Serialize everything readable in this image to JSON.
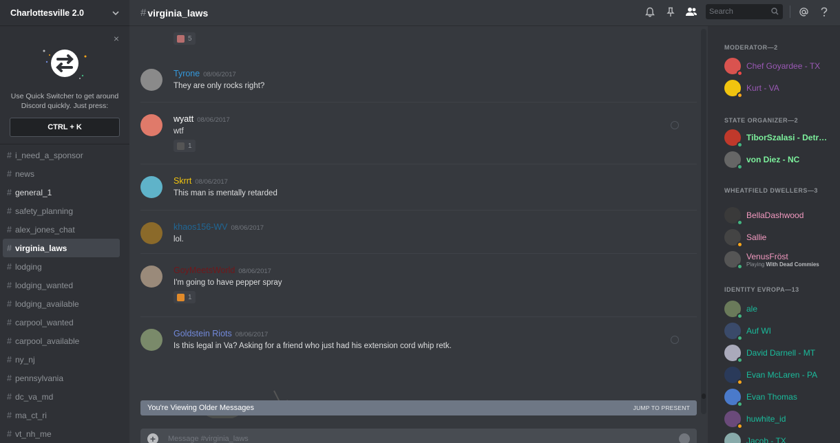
{
  "guild": {
    "name": "Charlottesville 2.0"
  },
  "quick_switcher": {
    "text_line1": "Use Quick Switcher to get around",
    "text_line2": "Discord quickly. Just press:",
    "shortcut": "CTRL + K",
    "close": "×"
  },
  "channels": [
    {
      "name": "i_need_a_sponsor",
      "state": "normal"
    },
    {
      "name": "news",
      "state": "normal"
    },
    {
      "name": "general_1",
      "state": "bright"
    },
    {
      "name": "safety_planning",
      "state": "normal"
    },
    {
      "name": "alex_jones_chat",
      "state": "normal"
    },
    {
      "name": "virginia_laws",
      "state": "active"
    },
    {
      "name": "lodging",
      "state": "normal"
    },
    {
      "name": "lodging_wanted",
      "state": "normal"
    },
    {
      "name": "lodging_available",
      "state": "normal"
    },
    {
      "name": "carpool_wanted",
      "state": "normal"
    },
    {
      "name": "carpool_available",
      "state": "normal"
    },
    {
      "name": "ny_nj",
      "state": "normal"
    },
    {
      "name": "pennsylvania",
      "state": "normal"
    },
    {
      "name": "dc_va_md",
      "state": "normal"
    },
    {
      "name": "ma_ct_ri",
      "state": "normal"
    },
    {
      "name": "vt_nh_me",
      "state": "normal"
    }
  ],
  "chat": {
    "hash": "#",
    "channel": "virginia_laws",
    "search_placeholder": "Search",
    "top_reaction_count": "5",
    "messages": [
      {
        "user": "Tyrone",
        "color": "#3498db",
        "time": "08/06/2017",
        "text": "They are only rocks right?",
        "reaction": ""
      },
      {
        "user": "wyatt",
        "color": "#ffffff",
        "time": "08/06/2017",
        "text": "wtf",
        "reaction": "1"
      },
      {
        "user": "Skrrt",
        "color": "#f1c40f",
        "time": "08/06/2017",
        "text": "This man is mentally retarded",
        "reaction": ""
      },
      {
        "user": "khaos156-WV",
        "color": "#206694",
        "time": "08/06/2017",
        "text": "lol.",
        "reaction": ""
      },
      {
        "user": "GoyMeetsWorld",
        "color": "#71171a",
        "time": "08/06/2017",
        "text": "I'm going to have pepper spray",
        "reaction": "1"
      },
      {
        "user": "Goldstein Riots",
        "color": "#7289da",
        "time": "08/06/2017",
        "text": "Is this legal in Va?  Asking for a friend who just had his extension cord whip retk.",
        "reaction": ""
      }
    ],
    "older_notice": "You're Viewing Older Messages",
    "jump_label": "JUMP TO PRESENT",
    "composer_placeholder": "Message #virginia_laws"
  },
  "members": {
    "groups": [
      {
        "title": "MODERATOR—2",
        "members": [
          {
            "name": "Chef Goyardee - TX",
            "color": "#9b59b6",
            "bold": false,
            "status": "#f04747"
          },
          {
            "name": "Kurt - VA",
            "color": "#9b59b6",
            "bold": false,
            "status": "#faa61a"
          }
        ]
      },
      {
        "title": "STATE ORGANIZER—2",
        "members": [
          {
            "name": "TiborSzalasi - Detr…",
            "color": "#7cf09c",
            "bold": true,
            "status": "#43b581"
          },
          {
            "name": "von Diez - NC",
            "color": "#7cf09c",
            "bold": true,
            "status": "#43b581"
          }
        ]
      },
      {
        "title": "WHEATFIELD DWELLERS—3",
        "members": [
          {
            "name": "BellaDashwood",
            "color": "#f49ac1",
            "bold": false,
            "status": "#43b581"
          },
          {
            "name": "Sallie",
            "color": "#f49ac1",
            "bold": false,
            "status": "#faa61a"
          },
          {
            "name": "VenusFröst",
            "color": "#f49ac1",
            "bold": false,
            "status": "#43b581",
            "playing_prefix": "Playing",
            "playing_game": "With Dead Commies"
          }
        ]
      },
      {
        "title": "IDENTITY EVROPA—13",
        "members": [
          {
            "name": "ale",
            "color": "#1abc9c",
            "bold": false,
            "status": "#43b581"
          },
          {
            "name": "Auf WI",
            "color": "#1abc9c",
            "bold": false,
            "status": "#43b581"
          },
          {
            "name": "David Darnell - MT",
            "color": "#1abc9c",
            "bold": false,
            "status": "#43b581"
          },
          {
            "name": "Evan McLaren - PA",
            "color": "#1abc9c",
            "bold": false,
            "status": "#faa61a"
          },
          {
            "name": "Evan Thomas",
            "color": "#1abc9c",
            "bold": false,
            "status": "#43b581"
          },
          {
            "name": "huwhite_id",
            "color": "#1abc9c",
            "bold": false,
            "status": "#faa61a"
          },
          {
            "name": "Jacob - TX",
            "color": "#1abc9c",
            "bold": false,
            "status": "#43b581"
          }
        ]
      }
    ]
  }
}
